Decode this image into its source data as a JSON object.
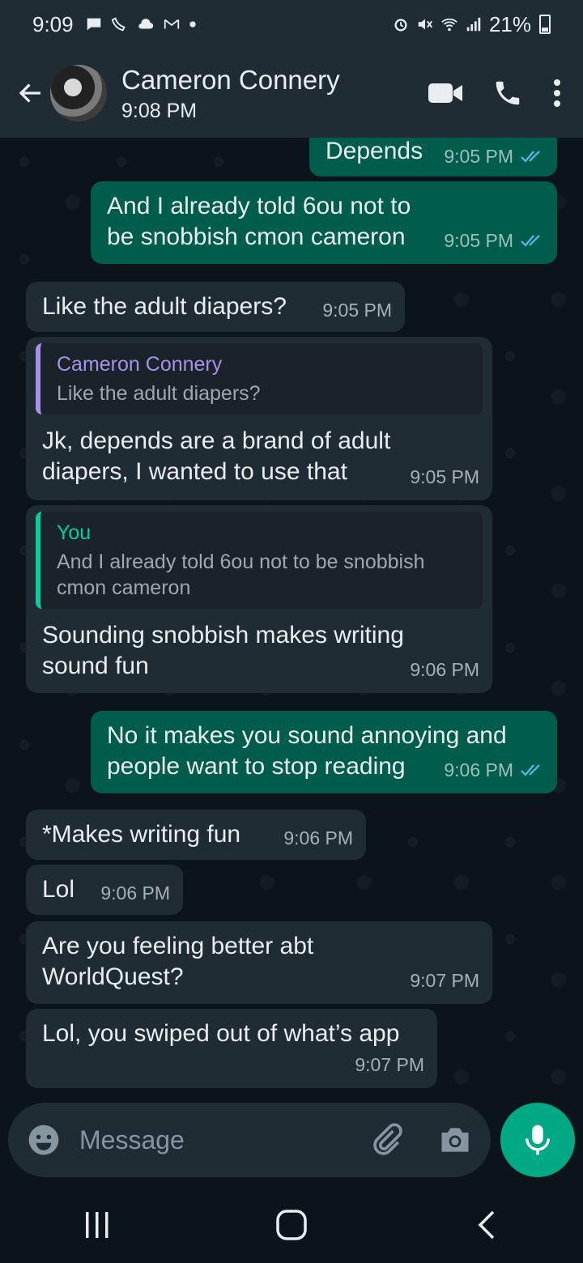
{
  "status_bar": {
    "time": "9:09",
    "battery": "21%",
    "left_icons": [
      "chat-bubble-icon",
      "wifi-call-icon",
      "cloud-icon",
      "gmail-icon",
      "dot-icon"
    ],
    "right_icons": [
      "alarm-icon",
      "mute-icon",
      "wifi-icon",
      "signal-icon",
      "battery-icon"
    ]
  },
  "header": {
    "contact_name": "Cameron Connery",
    "last_seen": "9:08 PM"
  },
  "messages": [
    {
      "direction": "out",
      "text": "Depends",
      "time": "9:05 PM",
      "read": true
    },
    {
      "direction": "out",
      "text": "And I already told 6ou not to be snobbish cmon cameron",
      "time": "9:05 PM",
      "read": true
    },
    {
      "direction": "in",
      "text": "Like the adult diapers?",
      "time": "9:05 PM"
    },
    {
      "direction": "in",
      "quote_name": "Cameron Connery",
      "quote_text": "Like the adult diapers?",
      "text": "Jk, depends are a brand of adult diapers, I wanted to use that",
      "time": "9:05 PM"
    },
    {
      "direction": "in",
      "quote_name": "You",
      "quote_text": "And I already told 6ou not to be snobbish cmon cameron",
      "text": "Sounding snobbish makes writing sound fun",
      "time": "9:06 PM"
    },
    {
      "direction": "out",
      "text": "No it makes you sound annoying and people want to stop reading",
      "time": "9:06 PM",
      "read": true
    },
    {
      "direction": "in",
      "text": "*Makes writing fun",
      "time": "9:06 PM"
    },
    {
      "direction": "in",
      "text": "Lol",
      "time": "9:06 PM"
    },
    {
      "direction": "in",
      "text": "Are you feeling better abt WorldQuest?",
      "time": "9:07 PM"
    },
    {
      "direction": "in",
      "text": "Lol, you swiped out of what’s app",
      "time": "9:07 PM"
    }
  ],
  "composer": {
    "placeholder": "Message"
  },
  "colors": {
    "outgoing_bubble": "#005c4b",
    "incoming_bubble": "#202c33",
    "accent": "#00a884",
    "read_tick": "#53bdeb",
    "quote_contact": "#a891e8",
    "quote_you": "#06cf9c"
  }
}
